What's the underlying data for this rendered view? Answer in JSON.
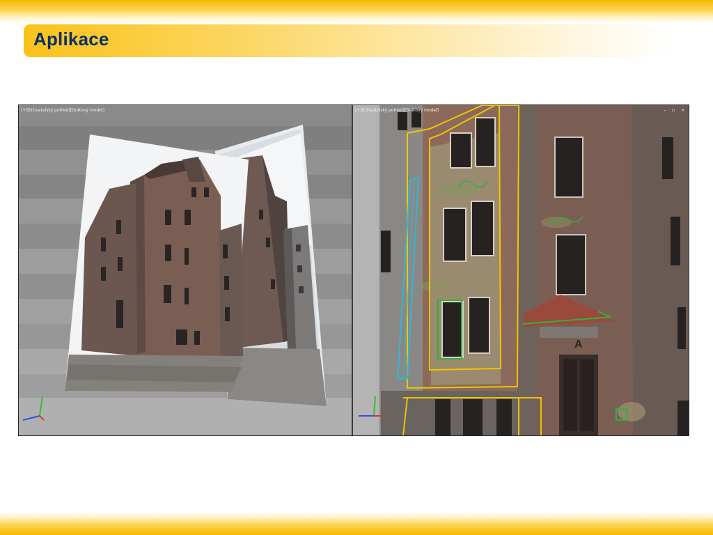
{
  "slide": {
    "title": "Aplikace"
  },
  "viewports": {
    "left": {
      "label": "[+][Uživatelský pohled][Drátový model]"
    },
    "right": {
      "label": "[+][Uživatelský pohled][Drátový model]",
      "controls": "– ▫ ×"
    }
  },
  "scene": {
    "door_sign": "A"
  },
  "colors": {
    "accent_yellow": "#f5b800",
    "title_text": "#0b2e6b",
    "outline_yellow": "#f2c400",
    "outline_green": "#2fb33a",
    "outline_cyan": "#32b6d6",
    "axis_x": "#e03030",
    "axis_y": "#30c030",
    "axis_z": "#3050e0"
  }
}
